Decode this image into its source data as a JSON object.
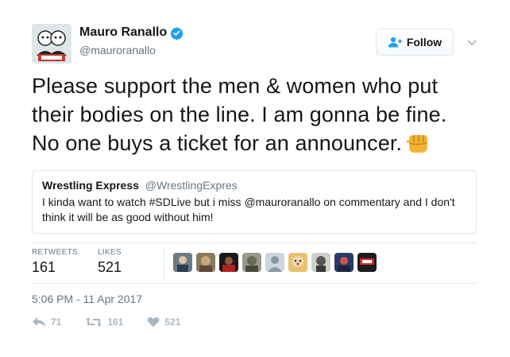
{
  "author": {
    "name": "Mauro Ranallo",
    "handle": "@mauroranallo"
  },
  "follow_label": "Follow",
  "tweet_lines": [
    "Please support the men & women who put",
    "their bodies on the line. I am gonna be fine.",
    "No one buys a ticket for an announcer."
  ],
  "quote": {
    "name": "Wrestling Express",
    "handle": "@WrestlingExpres",
    "text": "I kinda want to watch #SDLive but i miss @mauroranallo on commentary and I don't think it will be as good without him!"
  },
  "stats": {
    "retweets_label": "RETWEETS",
    "retweets": "161",
    "likes_label": "LIKES",
    "likes": "521"
  },
  "timestamp": "5:06 PM - 11 Apr 2017",
  "actions": {
    "reply": "71",
    "retweet": "161",
    "like": "521"
  },
  "colors": {
    "verified": "#1da1f2",
    "muted": "#657786",
    "action": "#aab8c2",
    "border": "#e1e8ed"
  },
  "icons": [
    "verified-badge-icon",
    "follow-person-icon",
    "caret-down-icon",
    "fist-emoji-icon",
    "reply-icon",
    "retweet-icon",
    "heart-icon"
  ]
}
